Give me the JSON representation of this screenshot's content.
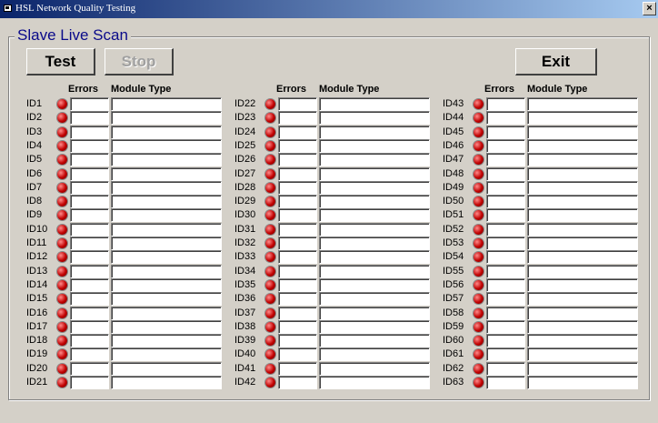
{
  "window": {
    "title": "HSL Network Quality Testing",
    "close_label": "×"
  },
  "group": {
    "title": "Slave Live Scan"
  },
  "buttons": {
    "test": "Test",
    "stop": "Stop",
    "exit": "Exit"
  },
  "columns": {
    "errors_header": "Errors",
    "module_header": "Module Type"
  },
  "slaves": [
    [
      "ID1",
      "ID2",
      "ID3",
      "ID4",
      "ID5",
      "ID6",
      "ID7",
      "ID8",
      "ID9",
      "ID10",
      "ID11",
      "ID12",
      "ID13",
      "ID14",
      "ID15",
      "ID16",
      "ID17",
      "ID18",
      "ID19",
      "ID20",
      "ID21"
    ],
    [
      "ID22",
      "ID23",
      "ID24",
      "ID25",
      "ID26",
      "ID27",
      "ID28",
      "ID29",
      "ID30",
      "ID31",
      "ID32",
      "ID33",
      "ID34",
      "ID35",
      "ID36",
      "ID37",
      "ID38",
      "ID39",
      "ID40",
      "ID41",
      "ID42"
    ],
    [
      "ID43",
      "ID44",
      "ID45",
      "ID46",
      "ID47",
      "ID48",
      "ID49",
      "ID50",
      "ID51",
      "ID52",
      "ID53",
      "ID54",
      "ID55",
      "ID56",
      "ID57",
      "ID58",
      "ID59",
      "ID60",
      "ID61",
      "ID62",
      "ID63"
    ]
  ],
  "status_led_color": "#c00000"
}
